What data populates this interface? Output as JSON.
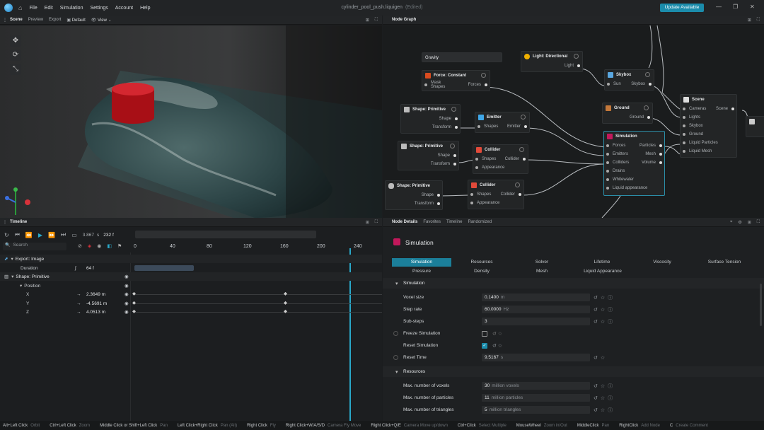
{
  "menu": [
    "File",
    "Edit",
    "Simulation",
    "Settings",
    "Account",
    "Help"
  ],
  "doc": {
    "title": "cylinder_pool_push.liquigen",
    "status": "(Edited)"
  },
  "update_label": "Update Available",
  "viewport_tabs": {
    "scene": "Scene",
    "preview": "Preview",
    "export": "Export",
    "camera": "Default",
    "view": "View"
  },
  "nodegraph_tab": "Node Graph",
  "nodes": {
    "gravity": "Gravity",
    "force_constant": {
      "title": "Force: Constant",
      "in": "Mask Shapes",
      "out": "Forces"
    },
    "light": {
      "title": "Light: Directional",
      "out": "Light"
    },
    "skybox": {
      "title": "Skybox",
      "in": "Sun",
      "out": "Skybox"
    },
    "scene": {
      "title": "Scene",
      "ins": [
        "Cameras",
        "Lights",
        "Skybox",
        "Ground",
        "Liquid Particles",
        "Liquid Mesh"
      ],
      "out": "Scene"
    },
    "ground": {
      "title": "Ground",
      "out": "Ground"
    },
    "shape1": {
      "title": "Shape: Primitive",
      "outs": [
        "Shape",
        "Transform"
      ]
    },
    "emitter": {
      "title": "Emitter",
      "in": "Shapes",
      "out": "Emitter"
    },
    "shape2": {
      "title": "Shape: Primitive",
      "outs": [
        "Shape",
        "Transform"
      ]
    },
    "collider1": {
      "title": "Collider",
      "in": "Shapes",
      "out": "Collider",
      "in2": "Appearance"
    },
    "shape3": {
      "title": "Shape: Primitive",
      "outs": [
        "Shape",
        "Transform"
      ]
    },
    "collider2": {
      "title": "Collider",
      "in": "Shapes",
      "out": "Collider",
      "in2": "Appearance"
    },
    "simulation": {
      "title": "Simulation",
      "rows": [
        [
          "Forces",
          "Particles"
        ],
        [
          "Emitters",
          "Mesh"
        ],
        [
          "Colliders",
          "Volume"
        ],
        [
          "Drains",
          ""
        ],
        [
          "Whitewater",
          ""
        ],
        [
          "Liquid appearance",
          ""
        ]
      ]
    }
  },
  "timeline": {
    "tab": "Timeline",
    "time": "3.867",
    "frame": "232 f",
    "search_placeholder": "Search",
    "ticks": [
      "0",
      "40",
      "80",
      "120",
      "160",
      "200",
      "240"
    ],
    "tracks": [
      {
        "label": "Export: Image",
        "value": ""
      },
      {
        "label": "Duration",
        "value": "64 f"
      },
      {
        "label": "Shape: Primitive",
        "value": ""
      },
      {
        "label": "Position",
        "value": ""
      },
      {
        "label": "X",
        "value": "2.3649 m"
      },
      {
        "label": "Y",
        "value": "-4.5691 m"
      },
      {
        "label": "Z",
        "value": "4.0513 m"
      }
    ]
  },
  "details": {
    "tabs": [
      "Node Details",
      "Favorites",
      "Timeline",
      "Randomized"
    ],
    "title": "Simulation",
    "cat_row1": [
      "Simulation",
      "Resources",
      "Solver",
      "Lifetime",
      "Viscosity",
      "Surface Tension"
    ],
    "cat_row2": [
      "Pressure",
      "Density",
      "Mesh",
      "Liquid Appearance"
    ],
    "section1": "Simulation",
    "props1": [
      {
        "label": "Voxel size",
        "value": "0.1400",
        "unit": "m"
      },
      {
        "label": "Step rate",
        "value": "60.0000",
        "unit": "Hz"
      },
      {
        "label": "Sub-steps",
        "value": "3",
        "unit": ""
      }
    ],
    "freeze": "Freeze Simulation",
    "reset": "Reset Simulation",
    "reset_time": {
      "label": "Reset Time",
      "value": "9.5167",
      "unit": "s"
    },
    "section2": "Resources",
    "props2": [
      {
        "label": "Max. number of voxels",
        "value": "30",
        "unit": "million voxels"
      },
      {
        "label": "Max. number of particles",
        "value": "11",
        "unit": "million particles"
      },
      {
        "label": "Max. number of triangles",
        "value": "5",
        "unit": "million triangles"
      }
    ]
  },
  "status": [
    [
      "Alt+Left Click",
      "Orbit"
    ],
    [
      "Ctrl+Left Click",
      "Zoom"
    ],
    [
      "Middle Click or Shift+Left Click",
      "Pan"
    ],
    [
      "Left Click+Right Click",
      "Pan (Alt)"
    ],
    [
      "Right Click",
      "Fly"
    ],
    [
      "Right Click+W/A/S/D",
      "Camera Fly Move"
    ],
    [
      "Right Click+Q/E",
      "Camera Move up/down"
    ],
    [
      "Ctrl+Click",
      "Select Multiple"
    ],
    [
      "MouseWheel",
      "Zoom in/Out"
    ],
    [
      "MiddleClick",
      "Pan"
    ],
    [
      "RightClick",
      "Add Node"
    ],
    [
      "C",
      "Create Comment"
    ]
  ],
  "colors": {
    "accent": "#1b8cab",
    "selected": "#2b8ea8",
    "playhead": "#2aa8c9",
    "cylinder": "#c8161b"
  }
}
